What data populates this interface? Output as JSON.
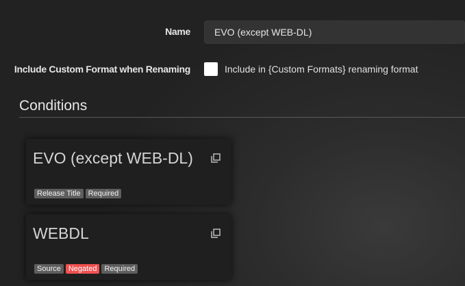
{
  "form": {
    "name_label": "Name",
    "name_value": "EVO (except WEB-DL)",
    "include_label": "Include Custom Format when Renaming",
    "include_help": "Include in {Custom Formats} renaming format",
    "include_checked": false
  },
  "conditions": {
    "title": "Conditions",
    "cards": [
      {
        "title": "EVO (except WEB-DL)",
        "icon": "clone-icon",
        "tags": [
          "Release Title",
          "Required"
        ]
      },
      {
        "title": "WEBDL",
        "icon": "clone-icon",
        "tags": [
          "Source",
          "Negated",
          "Required"
        ]
      }
    ]
  },
  "colors": {
    "tag_default": "#5e5e5e",
    "tag_negated": "#f05050",
    "card_bg": "#1f1f1f",
    "input_bg": "#333333"
  }
}
